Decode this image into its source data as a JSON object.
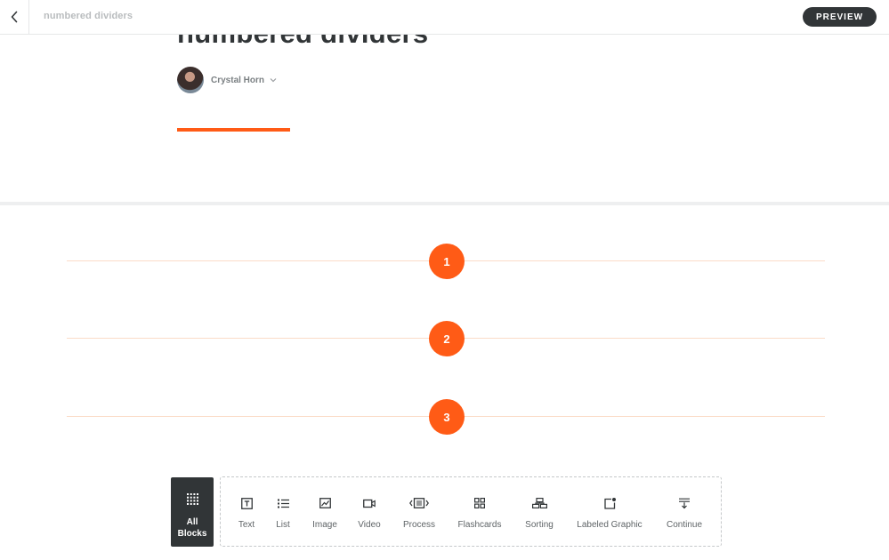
{
  "topbar": {
    "back_icon": "chevron-left-icon",
    "doc_title": "numbered dividers",
    "preview_label": "PREVIEW"
  },
  "lesson": {
    "title": "numbered dividers",
    "author": "Crystal Horn",
    "accent_color": "#ff5b16"
  },
  "dividers": [
    {
      "number": "1"
    },
    {
      "number": "2"
    },
    {
      "number": "3"
    }
  ],
  "block_toolbar": {
    "all_blocks_label_line1": "All",
    "all_blocks_label_line2": "Blocks",
    "items": [
      {
        "label": "Text",
        "icon": "text-block-icon"
      },
      {
        "label": "List",
        "icon": "list-icon"
      },
      {
        "label": "Image",
        "icon": "image-icon"
      },
      {
        "label": "Video",
        "icon": "video-icon"
      },
      {
        "label": "Process",
        "icon": "process-icon"
      },
      {
        "label": "Flashcards",
        "icon": "flashcards-icon"
      },
      {
        "label": "Sorting",
        "icon": "sorting-icon"
      },
      {
        "label": "Labeled Graphic",
        "icon": "labeled-graphic-icon"
      },
      {
        "label": "Continue",
        "icon": "continue-icon"
      }
    ]
  },
  "colors": {
    "accent": "#ff5b16",
    "dark": "#313537",
    "divider_line": "#fbdcc8"
  }
}
